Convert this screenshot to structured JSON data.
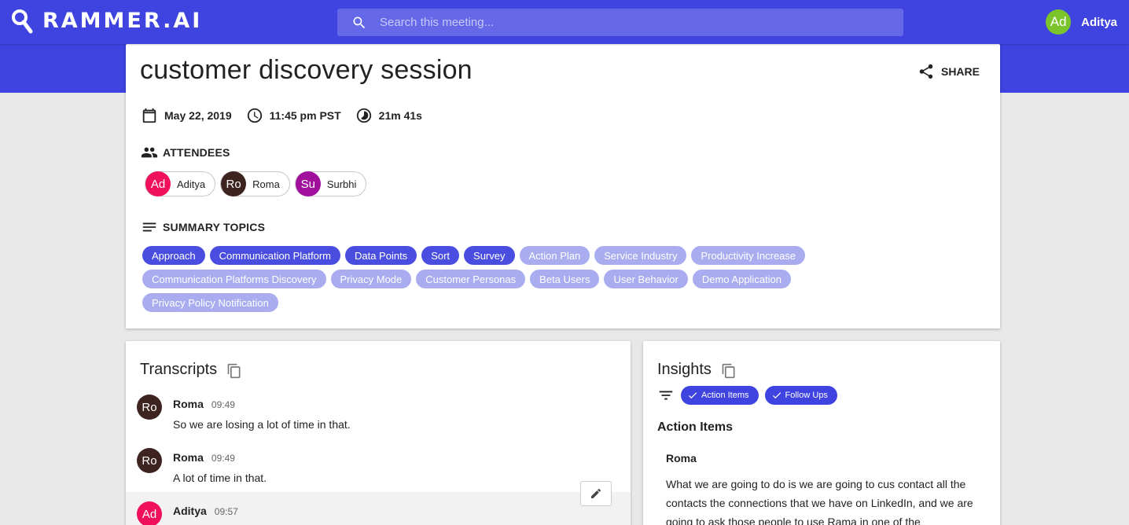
{
  "header": {
    "logo_text": "RAMMER.AI",
    "search_placeholder": "Search this meeting...",
    "user_initials": "Ad",
    "user_name": "Aditya"
  },
  "meeting": {
    "title": "customer discovery session",
    "share_label": "SHARE",
    "date": "May 22, 2019",
    "time": "11:45 pm PST",
    "duration": "21m 41s"
  },
  "attendees": {
    "label": "ATTENDEES",
    "items": [
      {
        "initials": "Ad",
        "name": "Aditya",
        "color": "#f0105b"
      },
      {
        "initials": "Ro",
        "name": "Roma",
        "color": "#3e2420"
      },
      {
        "initials": "Su",
        "name": "Surbhi",
        "color": "#a0109c"
      }
    ]
  },
  "summary": {
    "label": "SUMMARY TOPICS",
    "topics": [
      {
        "label": "Approach",
        "strength": "high"
      },
      {
        "label": "Communication Platform",
        "strength": "high"
      },
      {
        "label": "Data Points",
        "strength": "high"
      },
      {
        "label": "Sort",
        "strength": "high"
      },
      {
        "label": "Survey",
        "strength": "high"
      },
      {
        "label": "Action Plan",
        "strength": "low"
      },
      {
        "label": "Service Industry",
        "strength": "low"
      },
      {
        "label": "Productivity Increase",
        "strength": "low"
      },
      {
        "label": "Communication Platforms Discovery",
        "strength": "low"
      },
      {
        "label": "Privacy Mode",
        "strength": "low"
      },
      {
        "label": "Customer Personas",
        "strength": "low"
      },
      {
        "label": "Beta Users",
        "strength": "low"
      },
      {
        "label": "User Behavior",
        "strength": "low"
      },
      {
        "label": "Demo Application",
        "strength": "low"
      },
      {
        "label": "Privacy Policy Notification",
        "strength": "low"
      }
    ]
  },
  "transcripts": {
    "title": "Transcripts",
    "messages": [
      {
        "initials": "Ro",
        "speaker": "Roma",
        "time": "09:49",
        "text": "So we are losing a lot of time in that.",
        "color": "#3e2420"
      },
      {
        "initials": "Ro",
        "speaker": "Roma",
        "time": "09:49",
        "text": "A lot of time in that.",
        "color": "#3e2420"
      },
      {
        "initials": "Ad",
        "speaker": "Aditya",
        "time": "09:57",
        "text": "",
        "color": "#f0105b"
      }
    ]
  },
  "insights": {
    "title": "Insights",
    "filters": [
      "Action Items",
      "Follow Ups"
    ],
    "section_title": "Action Items",
    "item_speaker": "Roma",
    "item_text": "What we are going to do is we are going to cus contact all the contacts the connections that we have on LinkedIn, and we are going to ask those people to use Rama in one of the"
  },
  "colors": {
    "brand": "#3f43e0",
    "topic_high": "#4a4ee0",
    "topic_low": "#a9acef"
  }
}
